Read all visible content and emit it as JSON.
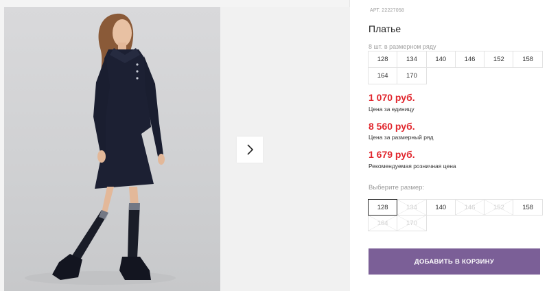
{
  "gallery": {
    "next_icon": "chevron-right-icon"
  },
  "product": {
    "art_label": "АРТ.",
    "art_number": "22227058",
    "title": "Платье"
  },
  "pack": {
    "label": "8 шт. в размерном ряду",
    "sizes": [
      "128",
      "134",
      "140",
      "146",
      "152",
      "158",
      "164",
      "170"
    ]
  },
  "prices": [
    {
      "value": "1 070 руб.",
      "description": "Цена за единицу"
    },
    {
      "value": "8 560 руб.",
      "description": "Цена за размерный ряд"
    },
    {
      "value": "1 679 руб.",
      "description": "Рекомендуемая розничная цена"
    }
  ],
  "size_select": {
    "label": "Выберите размер:",
    "options": [
      {
        "size": "128",
        "state": "selected"
      },
      {
        "size": "134",
        "state": "disabled"
      },
      {
        "size": "140",
        "state": "available"
      },
      {
        "size": "146",
        "state": "disabled"
      },
      {
        "size": "152",
        "state": "disabled"
      },
      {
        "size": "158",
        "state": "available"
      },
      {
        "size": "164",
        "state": "disabled"
      },
      {
        "size": "170",
        "state": "disabled"
      }
    ]
  },
  "cart_button_label": "ДОБАВИТЬ В КОРЗИНУ",
  "colors": {
    "price": "#e1262d",
    "button": "#7b5f97",
    "dress": "#1c2033"
  }
}
